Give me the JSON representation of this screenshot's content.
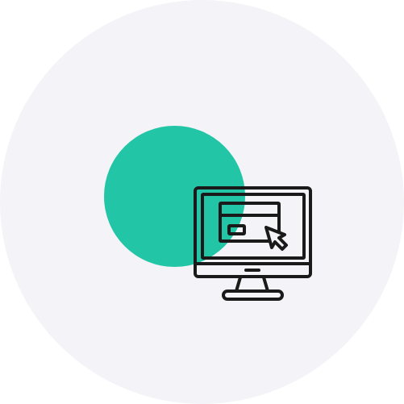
{
  "colors": {
    "background": "#ffffff",
    "backdrop_circle": "#f4f4f8",
    "accent_circle": "#22c5a6",
    "icon_stroke": "#1a1a1a"
  },
  "icon": {
    "name": "computer-monitor-card-click-icon"
  }
}
